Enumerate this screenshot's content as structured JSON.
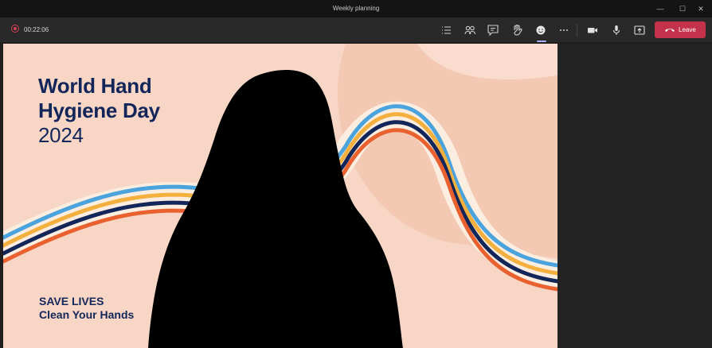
{
  "window": {
    "title": "Weekly planning"
  },
  "window_controls": {
    "minimize": "—",
    "maximize": "☐",
    "close": "✕"
  },
  "meeting": {
    "timer": "00:22:06"
  },
  "toolbar": {
    "icons": [
      "list-icon",
      "people-icon",
      "chat-icon",
      "raise-hand-icon",
      "reactions-icon",
      "more-icon",
      "camera-icon",
      "mic-icon",
      "share-icon"
    ],
    "active": "reactions-icon",
    "leave_label": "Leave",
    "leave_color": "#c4314b"
  },
  "background": {
    "headline_line1": "World Hand",
    "headline_line2": "Hygiene Day",
    "headline_year": "2024",
    "tagline_line1": "SAVE LIVES",
    "tagline_line2": "Clean Your Hands",
    "colors": {
      "bg": "#f7d6c6",
      "navy": "#13265a",
      "blue": "#4aa3dd",
      "orange": "#f4b03e",
      "red": "#e8612f",
      "cream": "#fbeee0"
    }
  }
}
